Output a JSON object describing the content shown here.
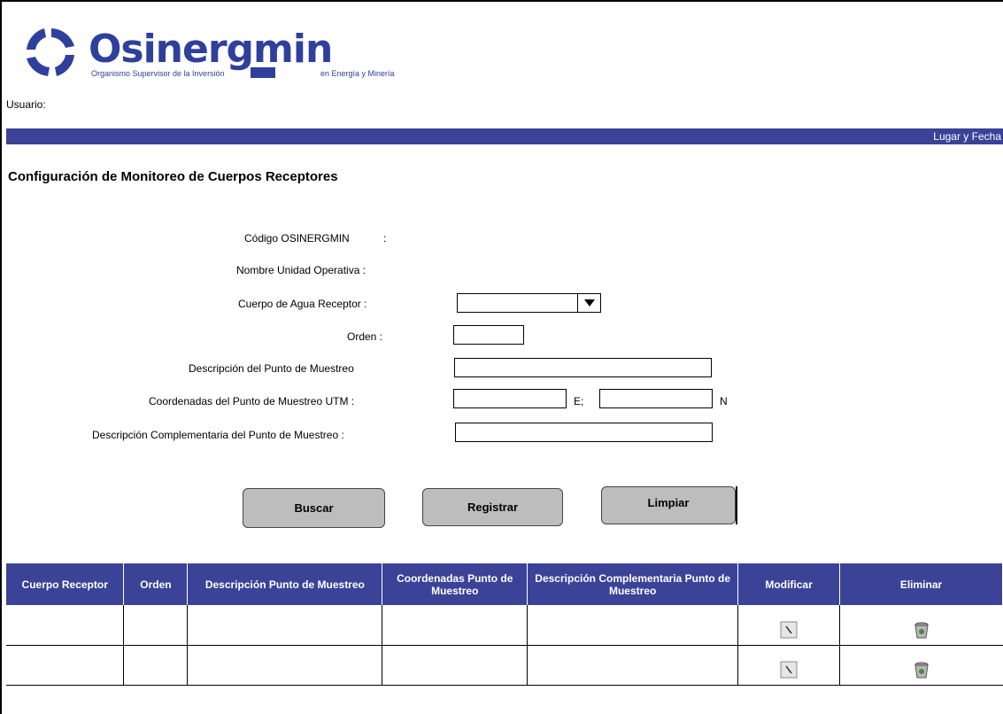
{
  "header": {
    "logo_name": "Osinergmin",
    "logo_tagline_left": "Organismo Supervisor de la Inversión",
    "logo_tagline_right": "en Energía y Minería",
    "user_label": "Usuario:",
    "bar_right_text": "Lugar y Fecha"
  },
  "page": {
    "title": "Configuración de Monitoreo de Cuerpos Receptores"
  },
  "form": {
    "codigo_label": "Código OSINERGMIN",
    "nombre_label": "Nombre Unidad Operativa :",
    "cuerpo_label": "Cuerpo de Agua Receptor :",
    "cuerpo_value": "",
    "orden_label": "Orden :",
    "orden_value": "",
    "descripcion_label": "Descripción del Punto de Muestreo",
    "descripcion_value": "",
    "coordenadas_label": "Coordenadas del Punto de Muestreo UTM :",
    "coord_e_value": "",
    "coord_e_suffix": "E;",
    "coord_n_value": "",
    "coord_n_suffix": "N",
    "desc_comp_label": "Descripción Complementaria del Punto de Muestreo :",
    "desc_comp_value": "",
    "colon": ":"
  },
  "buttons": {
    "buscar": "Buscar",
    "registrar": "Registrar",
    "limpiar": "Limpiar"
  },
  "table": {
    "columns": [
      "Cuerpo Receptor",
      "Orden",
      "Descripción Punto de Muestreo",
      "Coordenadas Punto de Muestreo",
      "Descripción Complementaria Punto de Muestreo",
      "Modificar",
      "Eliminar"
    ],
    "rows": [
      {
        "cuerpo": "",
        "orden": "",
        "descripcion": "",
        "coordenadas": "",
        "desc_comp": ""
      },
      {
        "cuerpo": "",
        "orden": "",
        "descripcion": "",
        "coordenadas": "",
        "desc_comp": ""
      }
    ]
  },
  "colors": {
    "brand_blue": "#3a4397",
    "button_gray": "#bdbdbd"
  },
  "icons": {
    "modify": "edit-icon",
    "delete": "trash-icon",
    "dropdown": "chevron-down-icon"
  }
}
